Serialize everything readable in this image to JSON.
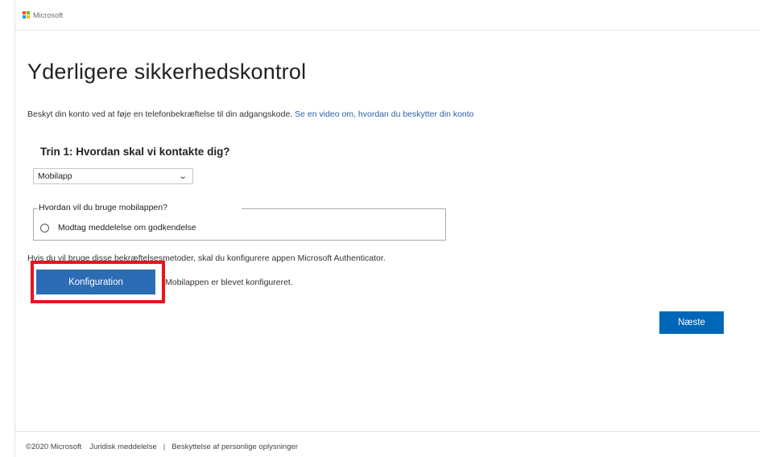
{
  "brand": {
    "name": "Microsoft",
    "logo_colors": [
      "#f25022",
      "#7fba00",
      "#00a4ef",
      "#ffb900"
    ]
  },
  "page": {
    "title": "Yderligere sikkerhedskontrol",
    "intro_text": "Beskyt din konto ved at føje en telefonbekræftelse til din adgangskode.",
    "intro_link": "Se en video om, hvordan du beskytter din konto"
  },
  "step1": {
    "heading": "Trin 1: Hvordan skal vi kontakte dig?",
    "method_selected": "Mobilapp",
    "usage_legend": "Hvordan vil du bruge mobilappen?",
    "radio_option": "Modtag meddelelse om godkendelse",
    "help_text": "Hvis du vil bruge disse bekræftelsesmetoder, skal du konfigurere appen Microsoft Authenticator.",
    "config_button": "Konfiguration",
    "configured_text": "Mobilappen er blevet konfigureret."
  },
  "actions": {
    "next_button": "Næste"
  },
  "colors": {
    "primary_button": "#0067b8",
    "config_button": "#2b6cb5",
    "highlight": "#e8141c",
    "link": "#2a62a8"
  },
  "footer": {
    "copyright": "©2020 Microsoft",
    "legal": "Juridisk meddelelse",
    "separator": "|",
    "privacy": "Beskyttelse af personlige oplysninger"
  }
}
